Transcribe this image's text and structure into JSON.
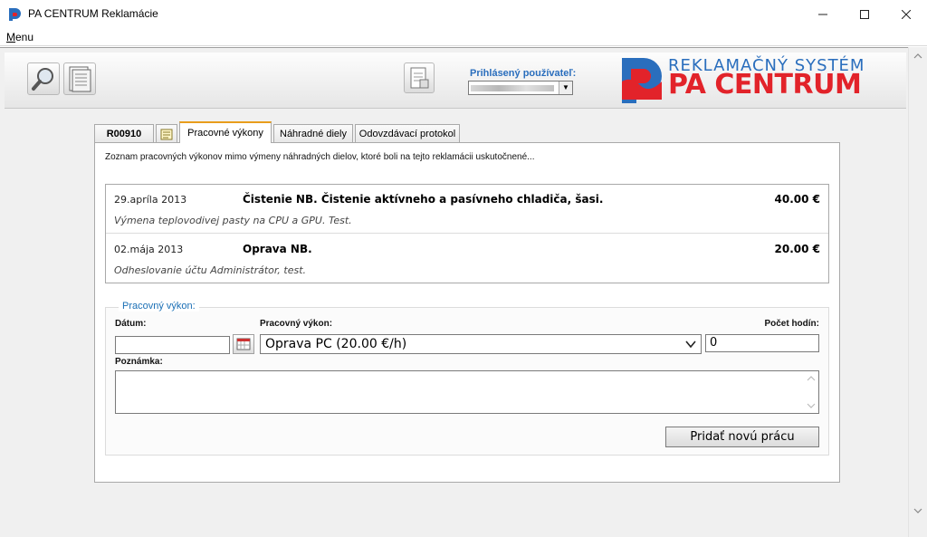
{
  "window": {
    "title": "PA CENTRUM Reklamácie",
    "controls": [
      "minimize",
      "maximize",
      "close"
    ]
  },
  "menu": {
    "items": [
      {
        "label_first": "M",
        "label_rest": "enu"
      }
    ]
  },
  "header": {
    "user_label": "Prihlásený používateľ:",
    "user_value": "",
    "logo": {
      "line1": "REKLAMAČNÝ SYSTÉM",
      "line2": "PA CENTRUM"
    }
  },
  "tabs": [
    {
      "label": "R00910",
      "active": false
    },
    {
      "label": "",
      "icon": "notepad-icon",
      "active": false
    },
    {
      "label": "Pracovné výkony",
      "active": true
    },
    {
      "label": "Náhradné diely",
      "active": false
    },
    {
      "label": "Odovzdávací protokol",
      "active": false
    }
  ],
  "panel": {
    "intro": "Zoznam pracovných výkonov mimo výmeny náhradných dielov, ktoré boli na tejto reklamácii uskutočnené...",
    "work_items": [
      {
        "date": "29.apríla 2013",
        "title": "Čistenie NB. Čistenie aktívneho a pasívneho chladiča, šasi.",
        "price": "40.00 €",
        "note": "Výmena teplovodivej pasty na CPU a GPU. Test."
      },
      {
        "date": "02.mája 2013",
        "title": "Oprava NB.",
        "price": "20.00 €",
        "note": "Odheslovanie účtu Administrátor, test."
      }
    ],
    "form": {
      "group_title": "Pracovný výkon:",
      "date_label": "Dátum:",
      "date_value": "",
      "work_label": "Pracovný výkon:",
      "work_value": "Oprava PC (20.00 €/h)",
      "hours_label": "Počet hodín:",
      "hours_value": "0",
      "note_label": "Poznámka:",
      "note_value": "",
      "submit_label": "Pridať novú prácu"
    }
  },
  "colors": {
    "accent": "#e89d1c",
    "link_blue": "#1a6fb5",
    "logo_red": "#e2232a",
    "logo_blue": "#2a6ebd"
  }
}
